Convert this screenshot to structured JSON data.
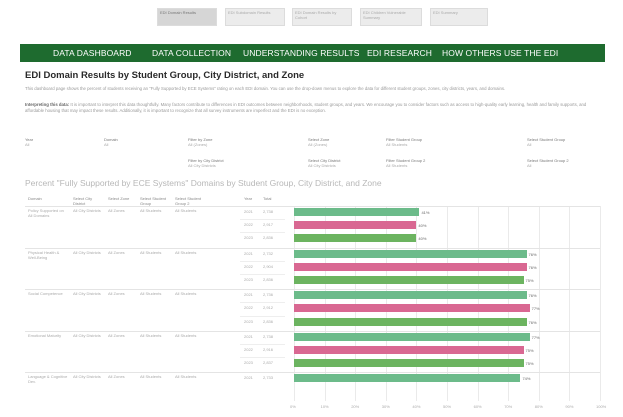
{
  "top_tabs": [
    {
      "label": "EDI Domain Results",
      "active": true
    },
    {
      "label": "EDI Subdomain Results",
      "active": false
    },
    {
      "label": "EDI Domain Results by Cohort",
      "active": false
    },
    {
      "label": "EDI Children Vulnerable Summary",
      "active": false
    },
    {
      "label": "EDI Summary",
      "active": false
    }
  ],
  "nav": {
    "items": [
      "DATA DASHBOARD",
      "DATA COLLECTION",
      "UNDERSTANDING RESULTS",
      "EDI RESEARCH",
      "HOW OTHERS USE THE EDI"
    ]
  },
  "page": {
    "title": "EDI Domain Results by Student Group, City District, and Zone",
    "description": "This dashboard page shows the percent of students receiving an \"Fully Supported by ECE Systems\" rating on each EDI domain. You can use the drop-down menus to explore the data for different student groups, zones, city districts, years, and domains.",
    "interpret_label": "Interpreting this data:",
    "interpret_text": "It is important to interpret this data thoughtfully. Many factors contribute to differences in EDI outcomes between neighborhoods, student groups, and years. We encourage you to consider factors such as access to high-quality early learning, health and family supports, and affordable housing that may impact these results. Additionally, it is important to recognize that all survey instruments are imperfect and the EDI is no exception."
  },
  "filters": [
    {
      "label": "Year",
      "value": "All"
    },
    {
      "label": "Domain",
      "value": "All"
    },
    {
      "label": "Filter by Zone",
      "value": "All (Zones)"
    },
    {
      "label": "Select Zone",
      "value": "All (Zones)"
    },
    {
      "label": "Filter Student Group",
      "value": "All Students"
    },
    {
      "label": "Select Student Group",
      "value": "All"
    },
    {
      "label": "Filter by City District",
      "value": "All City Districts"
    },
    {
      "label": "Select City District",
      "value": "All City Districts"
    },
    {
      "label": "Filter Student Group 2",
      "value": "All Students"
    },
    {
      "label": "Select Student Group 2",
      "value": "All"
    }
  ],
  "chart": {
    "title": "Percent \"Fully Supported by ECE Systems\" Domains by Student Group, City District, and Zone",
    "headers": [
      "Domain",
      "Select City District",
      "Select Zone",
      "Select Student Group",
      "Select Student Group 2",
      "Year",
      "Total"
    ],
    "x_ticks": [
      "0%",
      "10%",
      "20%",
      "30%",
      "40%",
      "50%",
      "60%",
      "70%",
      "80%",
      "90%",
      "100%"
    ],
    "colors": {
      "2021": "#6cbb8a",
      "2022": "#d96892",
      "2023": "#6cb460"
    }
  },
  "chart_data": {
    "type": "bar",
    "orientation": "horizontal",
    "xlim": [
      0,
      100
    ],
    "groups": [
      {
        "domain": "Policy Supported on All Domains",
        "district": "All City Districts",
        "zone": "All Zones",
        "group": "All Students",
        "group2": "All Students",
        "rows": [
          {
            "year": "2021",
            "total": "2,738",
            "value": 41
          },
          {
            "year": "2022",
            "total": "2,917",
            "value": 40
          },
          {
            "year": "2023",
            "total": "2,836",
            "value": 40
          }
        ]
      },
      {
        "domain": "Physical Health & Well-Being",
        "district": "All City Districts",
        "zone": "All Zones",
        "group": "All Students",
        "group2": "All Students",
        "rows": [
          {
            "year": "2021",
            "total": "2,732",
            "value": 76
          },
          {
            "year": "2022",
            "total": "2,904",
            "value": 76
          },
          {
            "year": "2023",
            "total": "2,836",
            "value": 75
          }
        ]
      },
      {
        "domain": "Social Competence",
        "district": "All City Districts",
        "zone": "All Zones",
        "group": "All Students",
        "group2": "All Students",
        "rows": [
          {
            "year": "2021",
            "total": "2,736",
            "value": 76
          },
          {
            "year": "2022",
            "total": "2,912",
            "value": 77
          },
          {
            "year": "2023",
            "total": "2,836",
            "value": 76
          }
        ]
      },
      {
        "domain": "Emotional Maturity",
        "district": "All City Districts",
        "zone": "All Zones",
        "group": "All Students",
        "group2": "All Students",
        "rows": [
          {
            "year": "2021",
            "total": "2,738",
            "value": 77
          },
          {
            "year": "2022",
            "total": "2,916",
            "value": 75
          },
          {
            "year": "2023",
            "total": "2,837",
            "value": 75
          }
        ]
      },
      {
        "domain": "Language & Cognitive Dev.",
        "district": "All City Districts",
        "zone": "All Zones",
        "group": "All Students",
        "group2": "All Students",
        "rows": [
          {
            "year": "2021",
            "total": "2,733",
            "value": 74
          }
        ]
      }
    ]
  }
}
